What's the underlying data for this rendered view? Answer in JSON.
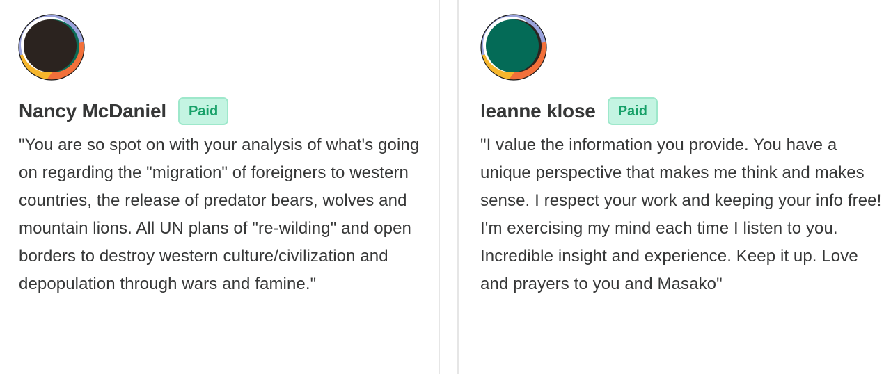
{
  "testimonials": [
    {
      "name": "Nancy McDaniel",
      "badge": "Paid",
      "quote": "\"You are so spot on with your analysis of what's going on regarding the \"migration\" of foreigners to western countries, the release of predator bears, wolves and mountain lions. All UN plans of \"re-wilding\" and open borders to destroy western culture/civilization and depopulation through wars and famine.\"",
      "avatar_color": "#2b231f"
    },
    {
      "name": "leanne klose",
      "badge": "Paid",
      "quote": "\"I value the information you provide. You have a unique perspective that makes me think and makes sense. I respect your work and keeping your info free! I'm exercising my mind each time I listen to you. Incredible insight and experience. Keep it up. Love and prayers to you and Masako\"",
      "avatar_color": "#046b57"
    }
  ],
  "colors": {
    "badge_text": "#16a068",
    "badge_bg": "#c4f4e2",
    "text": "#363737",
    "avatar_accent_orange": "#f2703a",
    "avatar_accent_yellow": "#f6b62c",
    "avatar_accent_lavender": "#9aa3dc"
  }
}
